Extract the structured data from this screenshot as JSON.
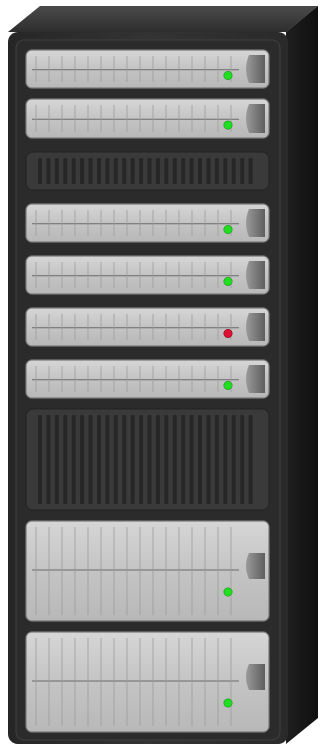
{
  "rack": {
    "colors": {
      "cabinet_front": "#2f2f2f",
      "cabinet_side": "#1a1a1a",
      "cabinet_top": "#3a3a3a",
      "unit_face": "#c8c8c8",
      "blank_panel": "#3a3a3a",
      "led_ok": "#22dd22",
      "led_fault": "#dd1133"
    },
    "units": [
      {
        "type": "server-1u",
        "status": "ok"
      },
      {
        "type": "server-1u",
        "status": "ok"
      },
      {
        "type": "blank-1u",
        "status": "none"
      },
      {
        "type": "server-1u",
        "status": "ok"
      },
      {
        "type": "server-1u",
        "status": "ok"
      },
      {
        "type": "server-1u",
        "status": "fault"
      },
      {
        "type": "server-1u",
        "status": "ok"
      },
      {
        "type": "blank-2u",
        "status": "none"
      },
      {
        "type": "server-2u",
        "status": "ok"
      },
      {
        "type": "server-2u",
        "status": "ok"
      }
    ]
  }
}
